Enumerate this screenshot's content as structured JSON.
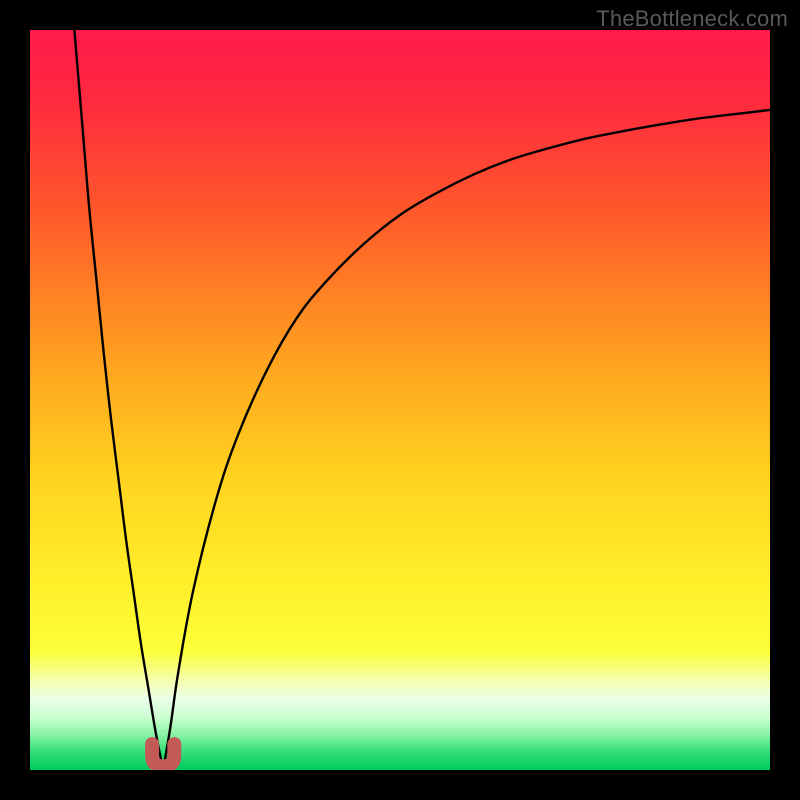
{
  "attribution": "TheBottleneck.com",
  "colors": {
    "frame": "#000000",
    "gradient_stops": [
      {
        "offset": 0.0,
        "color": "#ff1a4b"
      },
      {
        "offset": 0.1,
        "color": "#ff2b3e"
      },
      {
        "offset": 0.25,
        "color": "#ff5a2a"
      },
      {
        "offset": 0.45,
        "color": "#ffa31f"
      },
      {
        "offset": 0.6,
        "color": "#ffd21f"
      },
      {
        "offset": 0.75,
        "color": "#fff02a"
      },
      {
        "offset": 0.84,
        "color": "#fbff3a"
      },
      {
        "offset": 0.88,
        "color": "#f5ffb0"
      },
      {
        "offset": 0.905,
        "color": "#eaffea"
      },
      {
        "offset": 0.93,
        "color": "#c8ffcf"
      },
      {
        "offset": 0.955,
        "color": "#80f2a0"
      },
      {
        "offset": 0.975,
        "color": "#34df7a"
      },
      {
        "offset": 1.0,
        "color": "#00c95a"
      }
    ],
    "curve": "#000000",
    "marker_fill": "#c45a56",
    "marker_stroke": "#b44c49"
  },
  "chart_data": {
    "type": "line",
    "title": "",
    "xlabel": "",
    "ylabel": "",
    "xlim": [
      0,
      100
    ],
    "ylim": [
      0,
      100
    ],
    "optimum_x": 18,
    "series": [
      {
        "name": "left-branch",
        "x": [
          6,
          7,
          8,
          9,
          10,
          11,
          12,
          13,
          14,
          15,
          16,
          17,
          18
        ],
        "y": [
          100,
          88,
          76,
          66,
          56,
          47,
          39,
          31,
          24,
          17,
          11,
          5,
          0
        ]
      },
      {
        "name": "right-branch",
        "x": [
          18,
          19,
          20,
          22,
          25,
          28,
          32,
          36,
          40,
          45,
          50,
          55,
          60,
          65,
          70,
          75,
          80,
          85,
          90,
          95,
          100
        ],
        "y": [
          0,
          6,
          13,
          24,
          36,
          45,
          54,
          61,
          66,
          71,
          75,
          78,
          80.5,
          82.5,
          84,
          85.3,
          86.3,
          87.2,
          88,
          88.6,
          89.2
        ]
      }
    ],
    "marker": {
      "name": "optimum-marker",
      "shape": "u",
      "x_range": [
        16.5,
        19.5
      ],
      "y_range": [
        0.5,
        3.5
      ]
    }
  }
}
